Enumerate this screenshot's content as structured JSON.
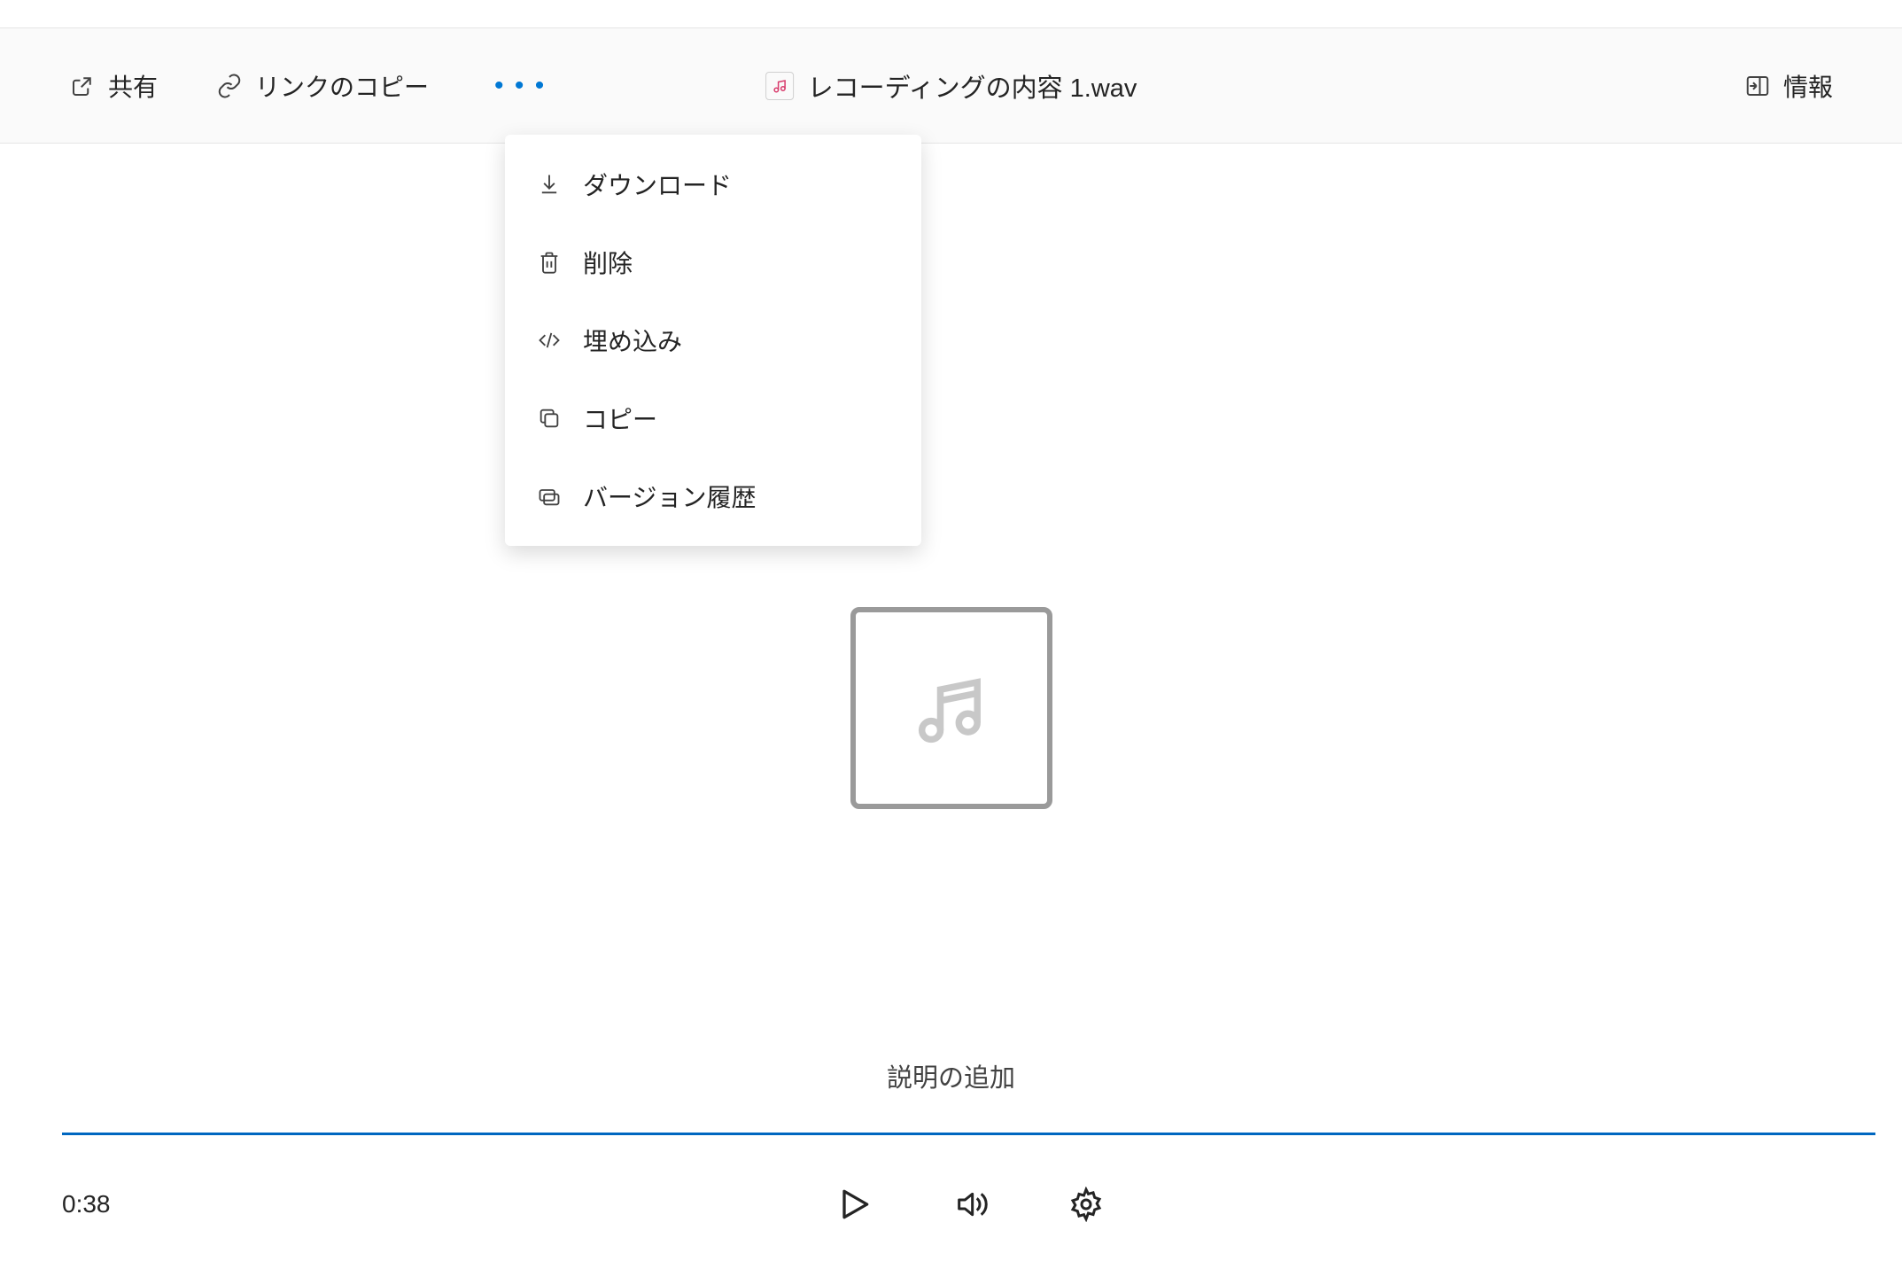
{
  "toolbar": {
    "share_label": "共有",
    "copy_link_label": "リンクのコピー",
    "file_name": "レコーディングの内容 1.wav",
    "info_label": "情報"
  },
  "dropdown": {
    "items": [
      {
        "label": "ダウンロード",
        "icon": "download"
      },
      {
        "label": "削除",
        "icon": "trash"
      },
      {
        "label": "埋め込み",
        "icon": "code"
      },
      {
        "label": "コピー",
        "icon": "copy"
      },
      {
        "label": "バージョン履歴",
        "icon": "version"
      }
    ]
  },
  "preview": {
    "add_description_label": "説明の追加"
  },
  "player": {
    "elapsed_time": "0:38",
    "progress_percent": 100
  }
}
